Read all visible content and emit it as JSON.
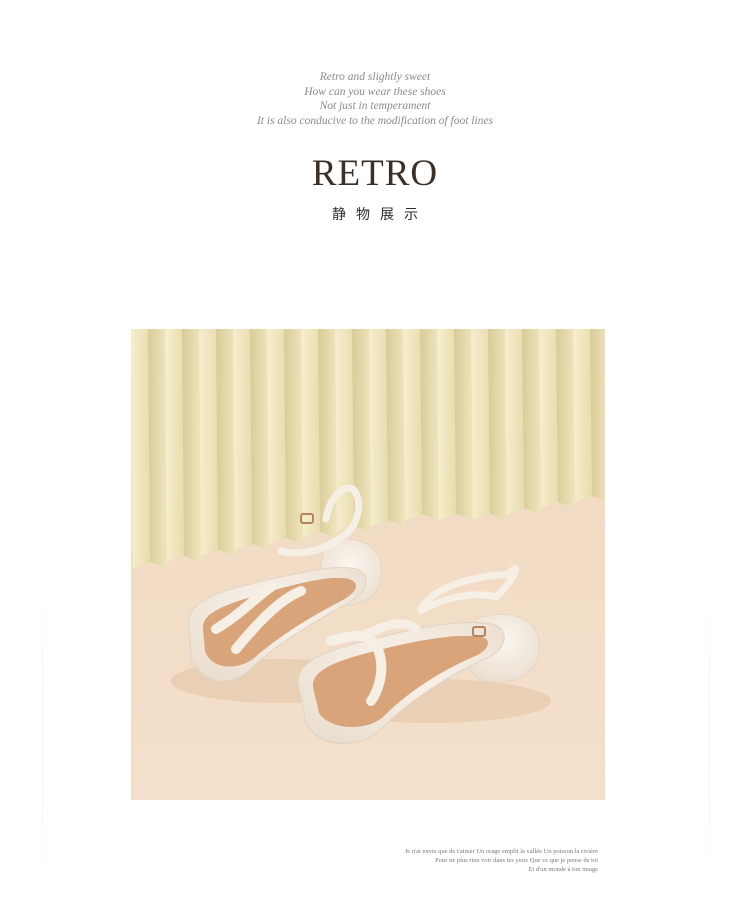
{
  "intro": {
    "lines": [
      "Retro and slightly sweet",
      "How can you wear these shoes",
      "Not just in temperament",
      "It is also conducive to the modification of foot lines"
    ]
  },
  "headline": "RETRO",
  "subtitle": "静物展示",
  "caption": {
    "lines": [
      "Je n'ai envie que de t'aimer Un orage emplit la vallée Un poisson la rivière",
      "Pour ne plus rien voir dans tes yeux Que ce que je pense de toi",
      "Et d'un monde à ton image"
    ]
  },
  "colors": {
    "background": "#ffffff",
    "headline": "#3b3026",
    "backdrop": "#f1dcc6",
    "pleats": "#efe6bf",
    "sandal": "#f5ece2",
    "insole": "#d9a47a"
  }
}
